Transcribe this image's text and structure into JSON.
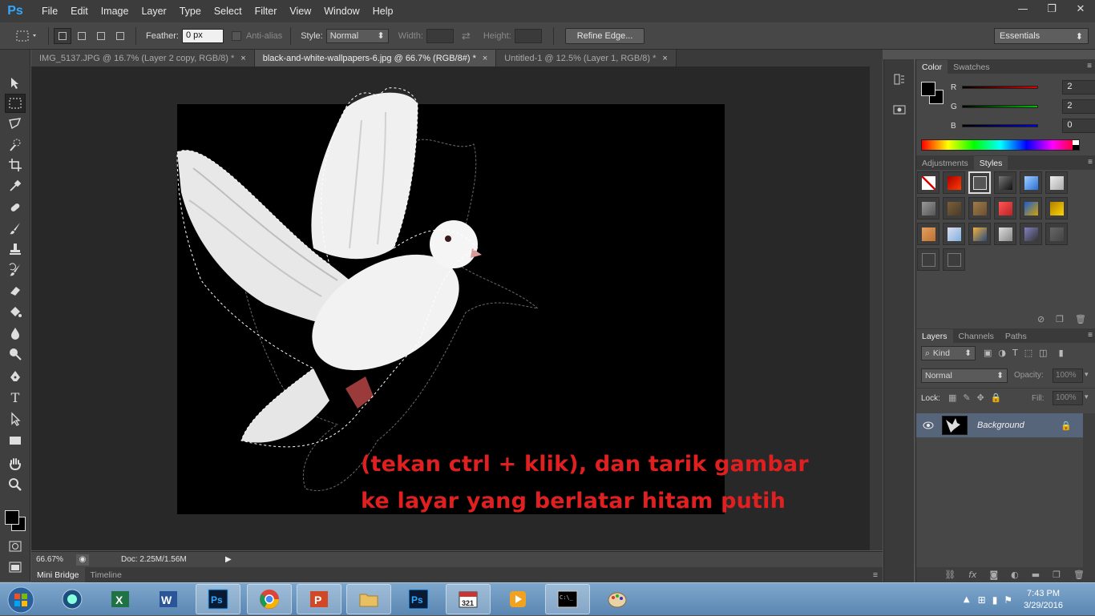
{
  "app": {
    "logo": "Ps"
  },
  "menu": [
    "File",
    "Edit",
    "Image",
    "Layer",
    "Type",
    "Select",
    "Filter",
    "View",
    "Window",
    "Help"
  ],
  "window_controls": {
    "minimize": "—",
    "restore": "❐",
    "close": "✕"
  },
  "options": {
    "feather_label": "Feather:",
    "feather_value": "0 px",
    "antialias_label": "Anti-alias",
    "style_label": "Style:",
    "style_value": "Normal",
    "width_label": "Width:",
    "height_label": "Height:",
    "refine_label": "Refine Edge...",
    "workspace": "Essentials"
  },
  "doc_tabs": [
    {
      "label": "IMG_5137.JPG @ 16.7% (Layer 2 copy, RGB/8) *",
      "close": "×"
    },
    {
      "label": "black-and-white-wallpapers-6.jpg @ 66.7% (RGB/8#) *",
      "close": "×"
    },
    {
      "label": "Untitled-1 @ 12.5% (Layer 1, RGB/8) *",
      "close": "×"
    }
  ],
  "overlay": {
    "line1": "(tekan ctrl + klik), dan tarik gambar",
    "line2": "ke layar yang berlatar hitam putih"
  },
  "status": {
    "zoom": "66.67%",
    "doc": "Doc: 2.25M/1.56M"
  },
  "bottom_tabs": [
    "Mini Bridge",
    "Timeline"
  ],
  "color_panel": {
    "tabs": [
      "Color",
      "Swatches"
    ],
    "channels": [
      {
        "label": "R",
        "value": "2",
        "color": "#e00000"
      },
      {
        "label": "G",
        "value": "2",
        "color": "#00b000"
      },
      {
        "label": "B",
        "value": "0",
        "color": "#0000e0"
      }
    ]
  },
  "styles_panel": {
    "tabs": [
      "Adjustments",
      "Styles"
    ]
  },
  "layers_panel": {
    "tabs": [
      "Layers",
      "Channels",
      "Paths"
    ],
    "kind_label": "Kind",
    "blend_mode": "Normal",
    "opacity_label": "Opacity:",
    "opacity_value": "100%",
    "lock_label": "Lock:",
    "fill_label": "Fill:",
    "fill_value": "100%",
    "layer_name": "Background"
  },
  "taskbar": {
    "time": "7:43 PM",
    "date": "3/29/2016"
  },
  "colors": {
    "accent": "#31a8ff",
    "overlay_text": "#e02020",
    "selected_layer": "#56657a"
  }
}
